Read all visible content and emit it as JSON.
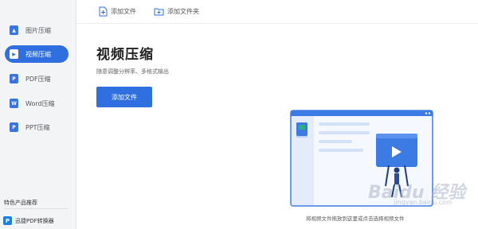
{
  "sidebar": {
    "items": [
      {
        "label": "图片压缩",
        "icon": "image-compress-icon",
        "badge": "▲",
        "active": false
      },
      {
        "label": "视频压缩",
        "icon": "video-compress-icon",
        "badge": "▶",
        "active": true
      },
      {
        "label": "PDF压缩",
        "icon": "pdf-compress-icon",
        "badge": "P",
        "active": false
      },
      {
        "label": "Word压缩",
        "icon": "word-compress-icon",
        "badge": "W",
        "active": false
      },
      {
        "label": "PPT压缩",
        "icon": "ppt-compress-icon",
        "badge": "P",
        "active": false
      }
    ],
    "promo_title": "特色产品推荐",
    "promo_item": {
      "label": "迅捷PDF转换器",
      "badge": "P",
      "icon": "pdf-converter-icon"
    }
  },
  "toolbar": {
    "add_file": "添加文件",
    "add_folder": "添加文件夹"
  },
  "main": {
    "title": "视频压缩",
    "subtitle": "随意调整分辨率、多格式输出",
    "add_button": "添加文件",
    "drop_hint": "将视频文件拖放到这里或点击选择视频文件"
  },
  "watermark": {
    "text": "Baidu 经验",
    "sub": "jingyan.baidu.com"
  },
  "colors": {
    "accent": "#2f6fdf",
    "sidebar_bg": "#f3f4f6"
  }
}
